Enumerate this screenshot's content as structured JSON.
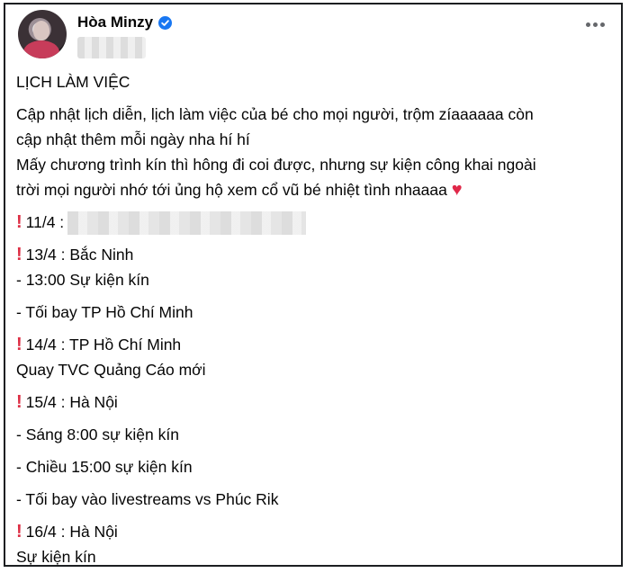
{
  "post": {
    "author": "Hòa Minzy",
    "title": "LỊCH LÀM VIỆC",
    "intro_lines": [
      "Cập nhật lịch diễn, lịch làm việc của bé cho mọi người, trộm zíaaaaaa còn",
      "cập nhật thêm mỗi ngày nha hí hí",
      "Mấy chương trình kín thì hông đi coi được, nhưng sự kiện công khai ngoài",
      "trời mọi người nhớ tới ủng hộ xem cổ vũ bé nhiệt tình nhaaaa"
    ],
    "schedule": [
      {
        "date": "11/4 :",
        "details": []
      },
      {
        "date": "13/4 : Bắc Ninh",
        "details": [
          "- 13:00 Sự kiện kín",
          "- Tối bay TP Hồ Chí Minh"
        ]
      },
      {
        "date": "14/4 : TP Hồ Chí Minh",
        "details": [
          "Quay TVC Quảng Cáo mới"
        ]
      },
      {
        "date": "15/4 : Hà Nội",
        "details": [
          "- Sáng 8:00 sự kiện kín",
          "- Chiều 15:00 sự kiện kín",
          "- Tối bay vào livestreams vs Phúc Rik"
        ]
      },
      {
        "date": "16/4 : Hà Nội",
        "details": [
          "Sự kiện kín"
        ]
      }
    ],
    "colors": {
      "verified": "#1877f2",
      "exclamation": "#dd2e44",
      "heart": "#e02849"
    }
  }
}
